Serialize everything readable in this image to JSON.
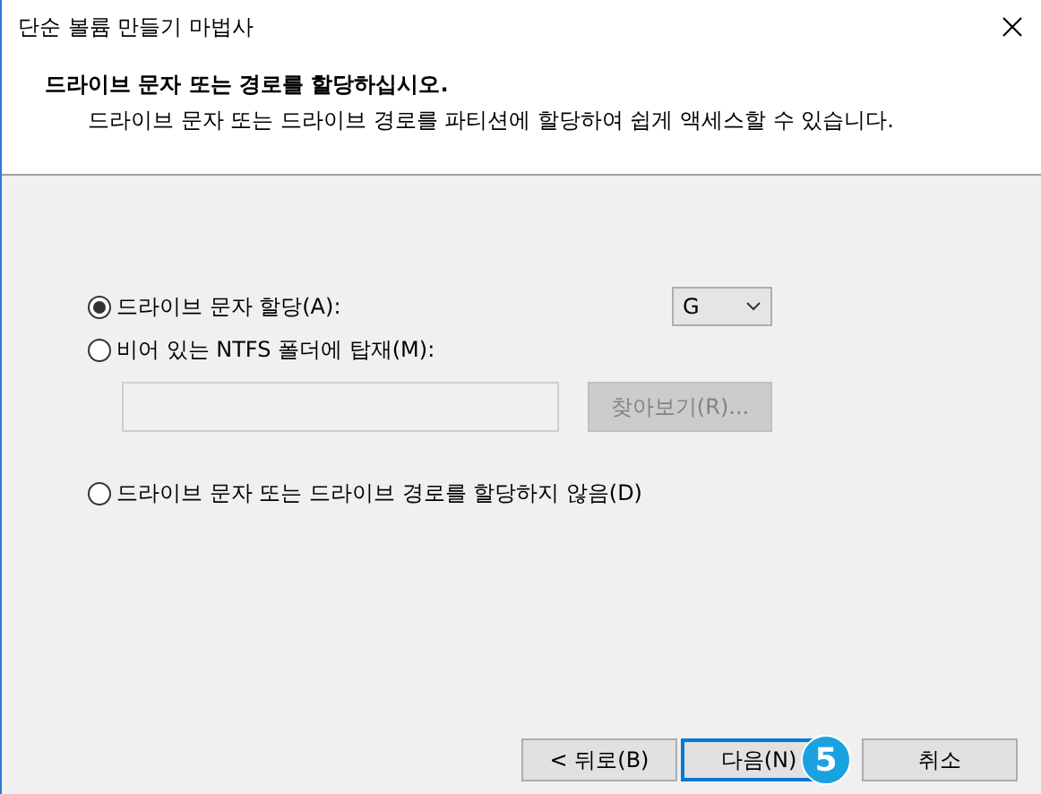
{
  "window": {
    "title": "단순 볼륨 만들기 마법사"
  },
  "header": {
    "heading": "드라이브 문자 또는 경로를 할당하십시오.",
    "subheading": "드라이브 문자 또는 드라이브 경로를 파티션에 할당하여 쉽게 액세스할 수 있습니다."
  },
  "options": [
    {
      "kind": "letter",
      "label": "드라이브 문자 할당(A):",
      "selected": true,
      "value": "G"
    },
    {
      "kind": "folder",
      "label": "비어 있는 NTFS 폴더에 탑재(M):",
      "selected": false,
      "browse_button": {
        "label": "찾아보기(R)...",
        "disabled": true
      }
    },
    {
      "kind": "none",
      "label": "드라이브 문자 또는 드라이브 경로를 할당하지 않음(D)",
      "selected": false
    }
  ],
  "buttons": [
    {
      "label": "< 뒤로(B)",
      "focused": false
    },
    {
      "label": "다음(N)",
      "focused": true
    },
    {
      "label": "취소",
      "focused": false
    }
  ],
  "step_badge": "5"
}
